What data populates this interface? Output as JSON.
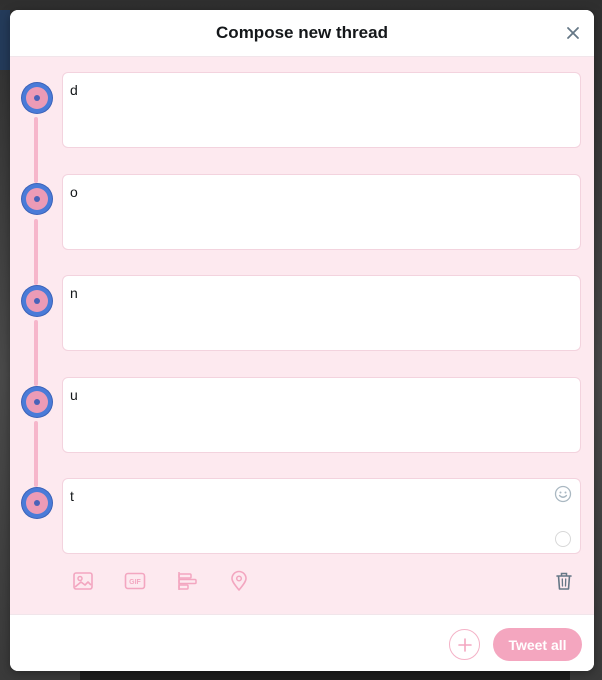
{
  "modal": {
    "title": "Compose new thread"
  },
  "thread": {
    "tweets": [
      {
        "text": "d"
      },
      {
        "text": "o"
      },
      {
        "text": "n"
      },
      {
        "text": "u"
      },
      {
        "text": "t"
      }
    ]
  },
  "toolbar": {
    "icons": [
      "image-icon",
      "gif-icon",
      "poll-icon",
      "location-icon",
      "trash-icon"
    ],
    "gif_label": "GIF"
  },
  "footer": {
    "tweet_all_label": "Tweet all"
  },
  "colors": {
    "accent_pink": "#f4a6bf",
    "thread_bg": "#fde9ef",
    "avatar_blue": "#4a7bd8",
    "avatar_pink": "#ec9bb6"
  }
}
